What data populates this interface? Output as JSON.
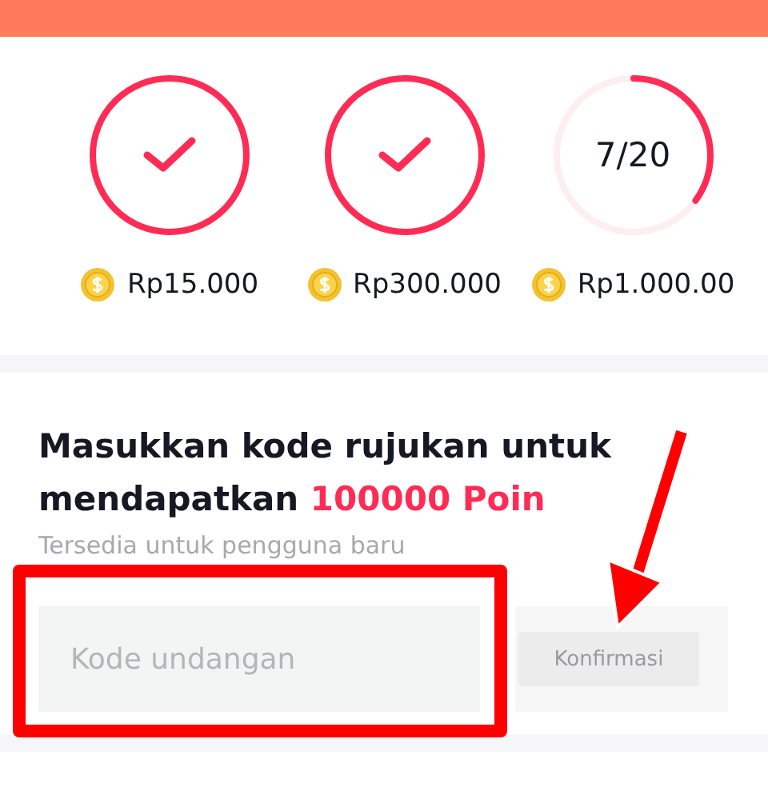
{
  "tasks": [
    {
      "kind": "done",
      "reward": "Rp15.000"
    },
    {
      "kind": "done",
      "reward": "Rp300.000"
    },
    {
      "kind": "progress",
      "progress": "7/20",
      "level": 0.35,
      "reward": "Rp1.000.00"
    }
  ],
  "referral": {
    "title_text": "Masukkan kode rujukan untuk mendapatkan ",
    "highlight": "100000 Poin",
    "subtitle": "Tersedia untuk pengguna baru",
    "placeholder": "Kode undangan",
    "button": "Konfirmasi",
    "button_disabled": true
  }
}
